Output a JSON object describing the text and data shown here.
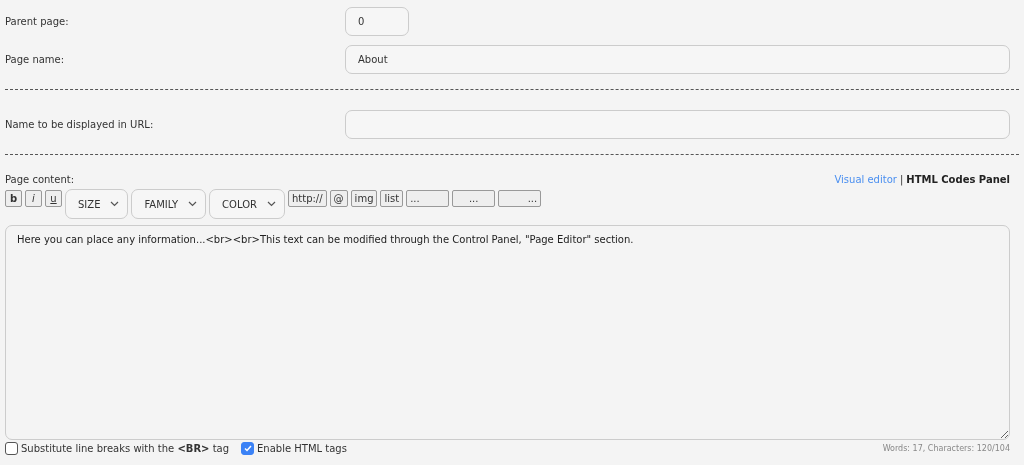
{
  "fields": [
    {
      "kind": "short",
      "label": "Parent page:",
      "value": "0"
    },
    {
      "kind": "text",
      "label": "Page name:",
      "value": "About"
    },
    {
      "kind": "divider"
    },
    {
      "kind": "text",
      "label": "Name to be displayed in URL:"
    },
    {
      "kind": "divider"
    }
  ],
  "content": {
    "label": "Page content:",
    "separator": "|",
    "modes": [
      {
        "label": "Visual editor",
        "selected": false
      },
      {
        "label": "HTML Codes Panel",
        "selected": true
      }
    ],
    "toolbar": [
      {
        "kind": "bold",
        "label": "b"
      },
      {
        "kind": "italic",
        "label": "i"
      },
      {
        "kind": "underline",
        "label": "u"
      },
      {
        "kind": "dropdown",
        "label": "SIZE"
      },
      {
        "kind": "dropdown",
        "label": "FAMILY"
      },
      {
        "kind": "dropdown",
        "label": "COLOR"
      },
      {
        "kind": "button",
        "label": "http://"
      },
      {
        "kind": "button",
        "label": "@"
      },
      {
        "kind": "button",
        "label": "img"
      },
      {
        "kind": "button",
        "label": "list"
      },
      {
        "kind": "wide",
        "label": "..."
      },
      {
        "kind": "wide",
        "label": "..."
      },
      {
        "kind": "wide",
        "label": "..."
      }
    ],
    "value": "Here you can place any information...<br><br>This text can be modified through the Control Panel, \"Page Editor\" section."
  },
  "options": [
    {
      "label": "Substitute line breaks with the **<BR>** tag",
      "checked": false
    },
    {
      "label": "Enable HTML tags",
      "checked": true
    }
  ],
  "counter": "Words: 17, Characters: 120/104"
}
